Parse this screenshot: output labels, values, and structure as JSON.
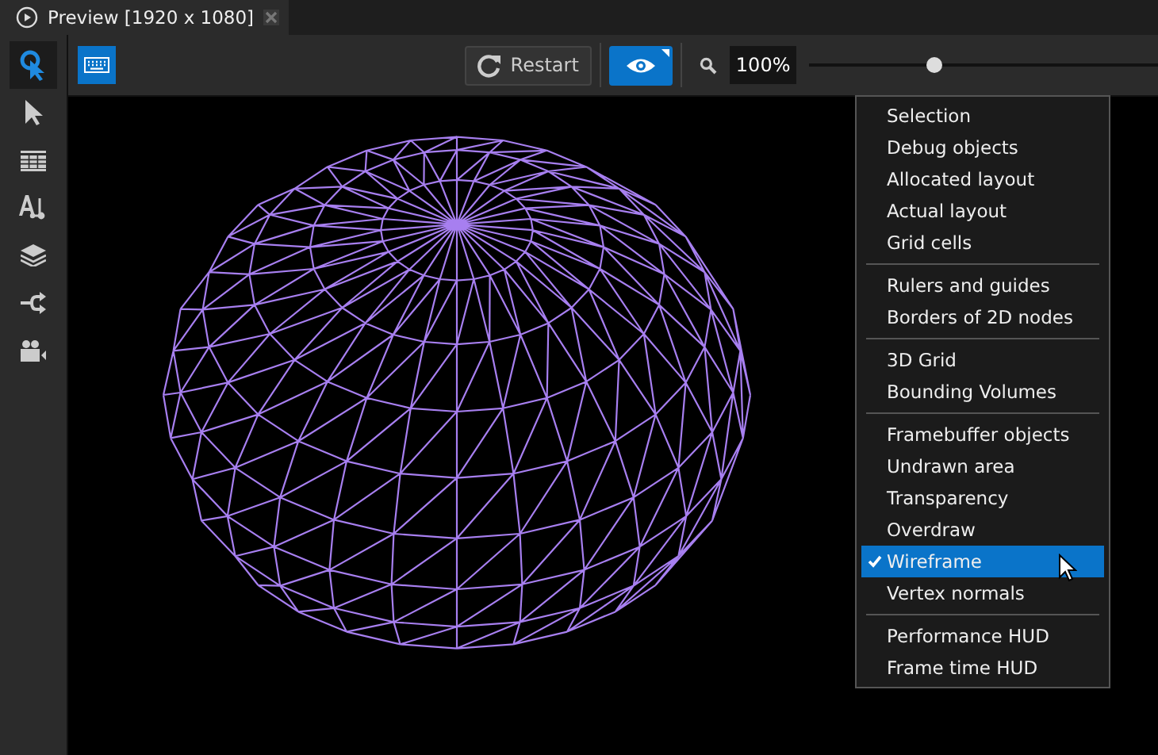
{
  "tab": {
    "title": "Preview [1920 x 1080]"
  },
  "sidebar": {
    "tools": [
      {
        "kind": "pick",
        "selected": true
      },
      {
        "kind": "pointer",
        "selected": false
      },
      {
        "kind": "table",
        "selected": false
      },
      {
        "kind": "text",
        "selected": false
      },
      {
        "kind": "layers",
        "selected": false
      },
      {
        "kind": "connect",
        "selected": false
      },
      {
        "kind": "camera",
        "selected": false
      }
    ]
  },
  "toolbar": {
    "keyboard_on": true,
    "restart": "Restart",
    "eye_on": true,
    "zoom": "100%",
    "zoom_slider": {
      "level": 0.36
    }
  },
  "menu": {
    "groups": [
      [
        {
          "label": "Selection",
          "checked": false,
          "selected": false
        },
        {
          "label": "Debug objects",
          "checked": false,
          "selected": false
        },
        {
          "label": "Allocated layout",
          "checked": false,
          "selected": false
        },
        {
          "label": "Actual layout",
          "checked": false,
          "selected": false
        },
        {
          "label": "Grid cells",
          "checked": false,
          "selected": false
        }
      ],
      [
        {
          "label": "Rulers and guides",
          "checked": false,
          "selected": false
        },
        {
          "label": "Borders of 2D nodes",
          "checked": false,
          "selected": false
        }
      ],
      [
        {
          "label": "3D Grid",
          "checked": false,
          "selected": false
        },
        {
          "label": "Bounding Volumes",
          "checked": false,
          "selected": false
        }
      ],
      [
        {
          "label": "Framebuffer objects",
          "checked": false,
          "selected": false
        },
        {
          "label": "Undrawn area",
          "checked": false,
          "selected": false
        },
        {
          "label": "Transparency",
          "checked": false,
          "selected": false
        },
        {
          "label": "Overdraw",
          "checked": false,
          "selected": false
        },
        {
          "label": "Wireframe",
          "checked": true,
          "selected": true
        },
        {
          "label": "Vertex normals",
          "checked": false,
          "selected": false
        }
      ],
      [
        {
          "label": "Performance HUD",
          "checked": false,
          "selected": false
        },
        {
          "label": "Frame time HUD",
          "checked": false,
          "selected": false
        }
      ]
    ]
  }
}
